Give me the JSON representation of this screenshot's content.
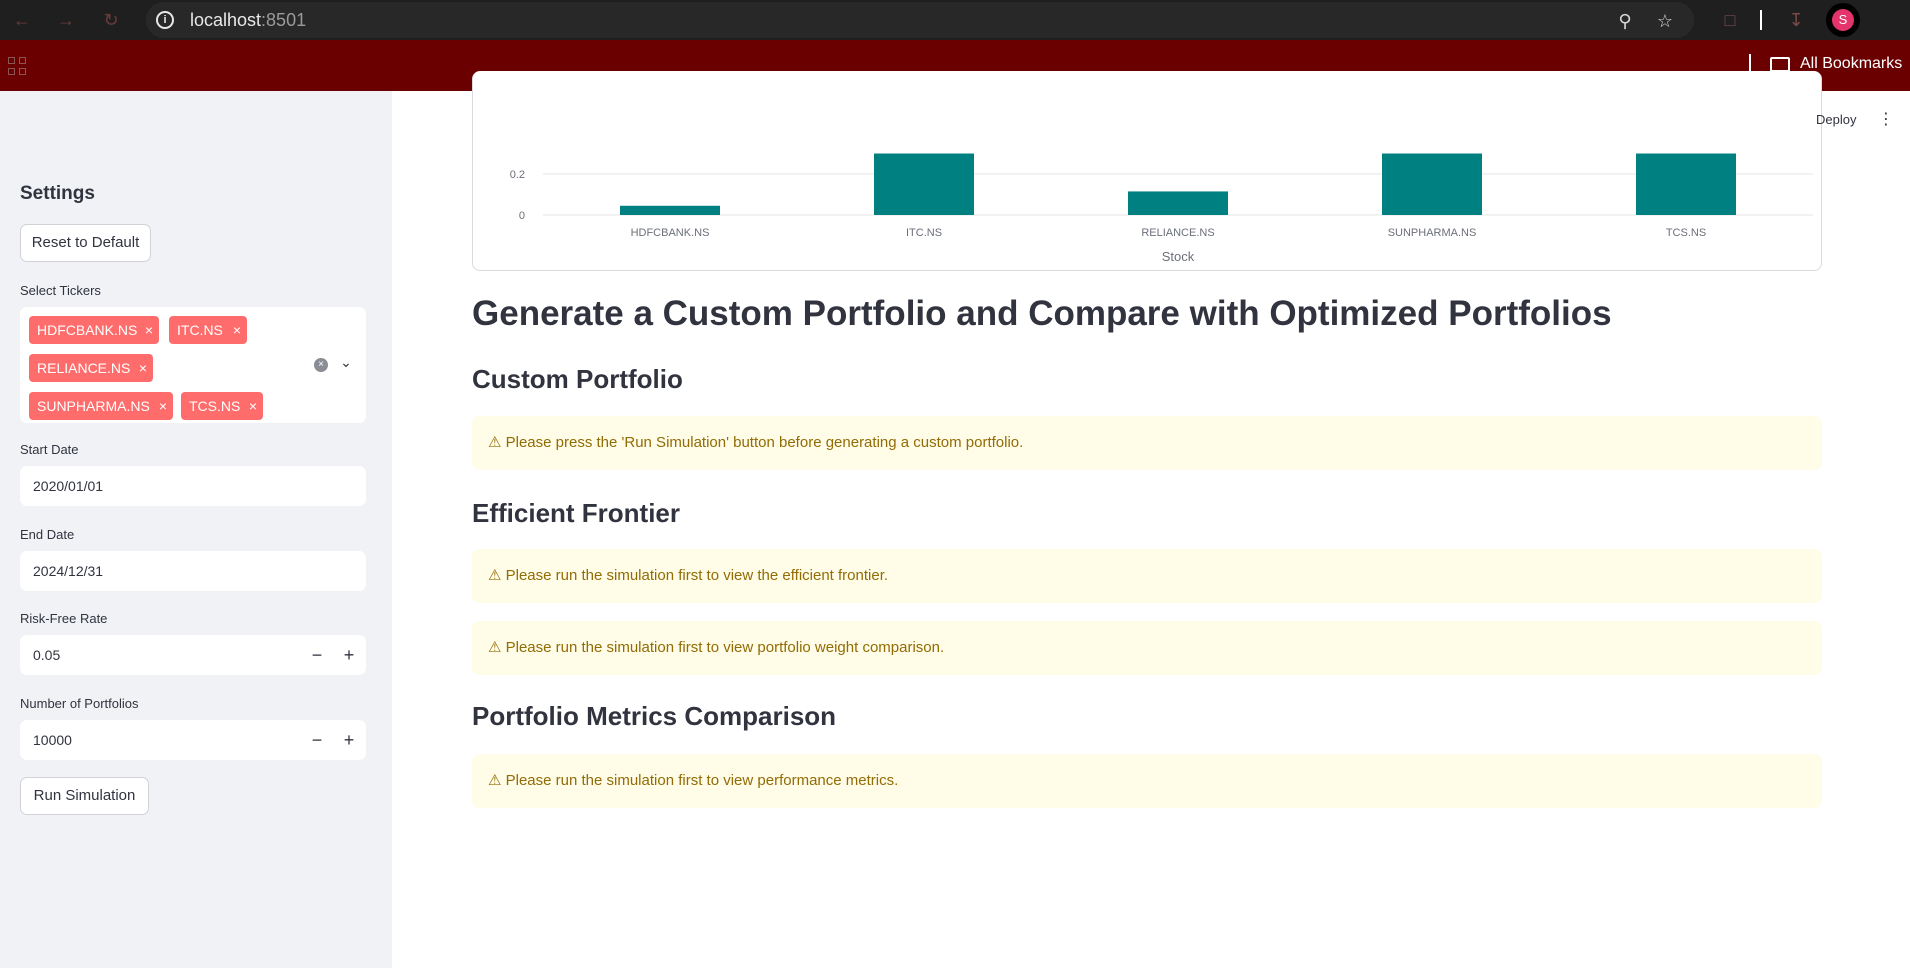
{
  "browser": {
    "url_host": "localhost",
    "url_port": ":8501",
    "bookmarks_label": "All Bookmarks",
    "profile_initial": "S"
  },
  "header": {
    "deploy_label": "Deploy"
  },
  "sidebar": {
    "title": "Settings",
    "reset_label": "Reset to Default",
    "tickers_label": "Select Tickers",
    "tickers": [
      "HDFCBANK.NS",
      "ITC.NS",
      "RELIANCE.NS",
      "SUNPHARMA.NS",
      "TCS.NS"
    ],
    "start_date_label": "Start Date",
    "start_date_value": "2020/01/01",
    "end_date_label": "End Date",
    "end_date_value": "2024/12/31",
    "risk_free_label": "Risk-Free Rate",
    "risk_free_value": "0.05",
    "num_portfolios_label": "Number of Portfolios",
    "num_portfolios_value": "10000",
    "run_label": "Run Simulation"
  },
  "chart_data": {
    "type": "bar",
    "categories": [
      "HDFCBANK.NS",
      "ITC.NS",
      "RELIANCE.NS",
      "SUNPHARMA.NS",
      "TCS.NS"
    ],
    "values": [
      0.045,
      0.3,
      0.115,
      0.3,
      0.3
    ],
    "xlabel": "Stock",
    "ytick_labels": [
      "0",
      "0.2"
    ],
    "y_visible_range": [
      0,
      0.2
    ],
    "bar_color": "#008080"
  },
  "main": {
    "page_heading": "Generate a Custom Portfolio and Compare with Optimized Portfolios",
    "custom_heading": "Custom Portfolio",
    "custom_warning": "⚠ Please press the 'Run Simulation' button before generating a custom portfolio.",
    "frontier_heading": "Efficient Frontier",
    "frontier_warning": "⚠ Please run the simulation first to view the efficient frontier.",
    "weights_warning": "⚠ Please run the simulation first to view portfolio weight comparison.",
    "metrics_heading": "Portfolio Metrics Comparison",
    "metrics_warning": "⚠ Please run the simulation first to view performance metrics."
  },
  "colors": {
    "accent": "#ff6c6c",
    "warning_bg": "#fffce7",
    "warning_text": "#926c05",
    "bookmark_bar": "#6b0000"
  }
}
